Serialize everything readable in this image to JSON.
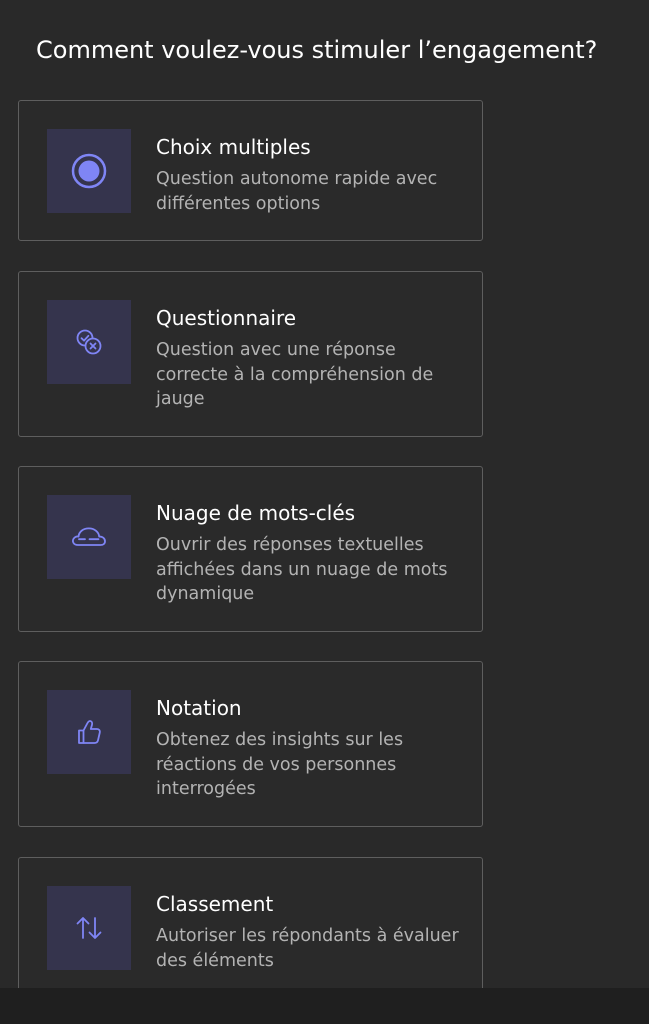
{
  "heading": "Comment voulez-vous stimuler l’engagement?",
  "accent_color": "#7f85f5",
  "options": [
    {
      "icon": "radio-selected-icon",
      "title": "Choix multiples",
      "description": "Question autonome rapide avec différentes options"
    },
    {
      "icon": "quiz-check-x-icon",
      "title": "Questionnaire",
      "description": "Question avec une réponse correcte à la compréhension de jauge"
    },
    {
      "icon": "word-cloud-icon",
      "title": "Nuage de mots-clés",
      "description": "Ouvrir des réponses textuelles affichées dans un nuage de mots dynamique"
    },
    {
      "icon": "thumbs-up-icon",
      "title": "Notation",
      "description": "Obtenez des insights sur les réactions de vos personnes interrogées"
    },
    {
      "icon": "arrows-up-down-icon",
      "title": "Classement",
      "description": "Autoriser les répondants à évaluer des éléments"
    }
  ]
}
